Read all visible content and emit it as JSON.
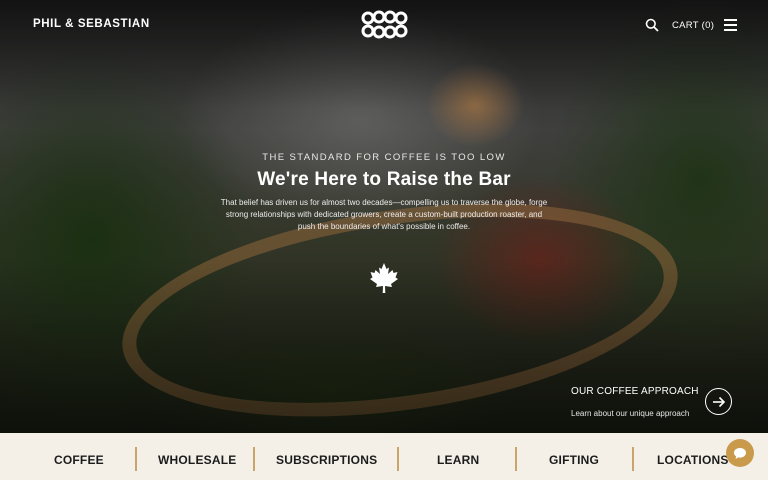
{
  "header": {
    "brand": "PHIL & SEBASTIAN",
    "cart_label": "CART (0)",
    "icons": [
      "logo-icon",
      "search-icon",
      "menu-icon"
    ]
  },
  "hero": {
    "eyebrow": "THE STANDARD FOR COFFEE IS TOO LOW",
    "headline": "We're Here to Raise the Bar",
    "subtext": "That belief has driven us for almost two decades—compelling us to traverse the globe, forge strong relationships with dedicated growers, create a custom-built production roaster, and push the boundaries of what's possible in coffee.",
    "emblem_icon": "maple-leaf-icon",
    "approach": {
      "title": "OUR COFFEE APPROACH",
      "subtitle": "Learn about our unique approach",
      "icon": "arrow-right-icon"
    }
  },
  "bottom_nav": {
    "items": [
      {
        "label": "COFFEE"
      },
      {
        "label": "WHOLESALE"
      },
      {
        "label": "SUBSCRIPTIONS"
      },
      {
        "label": "LEARN"
      },
      {
        "label": "GIFTING"
      },
      {
        "label": "LOCATIONS"
      }
    ],
    "divider_color": "#c9a56a",
    "background": "#f4f0e8"
  },
  "chat": {
    "icon": "chat-bubble-icon",
    "color": "#c99a4c"
  }
}
